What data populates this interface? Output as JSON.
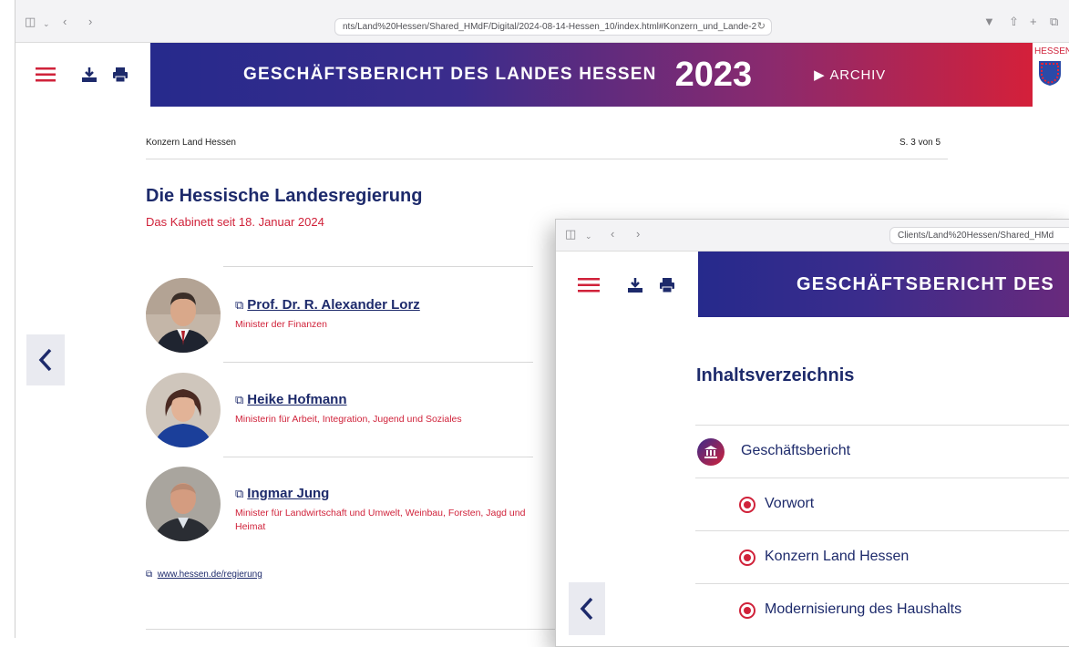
{
  "window1": {
    "url": "nts/Land%20Hessen/Shared_HMdF/Digital/2024-08-14-Hessen_10/index.html#Konzern_und_Lande-2",
    "toolbar": {
      "menu_icon": "hamburger-menu-icon",
      "download_icon": "download-icon",
      "print_icon": "print-icon"
    },
    "banner": {
      "title": "GESCHÄFTSBERICHT DES LANDES HESSEN",
      "year": "2023",
      "archive_label": "ARCHIV",
      "logo_text": "HESSEN"
    },
    "breadcrumb": "Konzern Land Hessen",
    "page_indicator": "S. 3 von 5",
    "heading": "Die Hessische Landesregierung",
    "subheading": "Das Kabinett seit 18. Januar 2024",
    "people": [
      {
        "name": "Prof. Dr. R. Alexander Lorz",
        "role": "Minister der Finanzen"
      },
      {
        "name": "Heike Hofmann",
        "role": "Ministerin für Arbeit, Integration, Jugend und Soziales"
      },
      {
        "name": "Ingmar Jung",
        "role": "Minister für Landwirtschaft und Umwelt, Weinbau, Forsten, Jagd und Heimat"
      }
    ],
    "weblink": "www.hessen.de/regierung"
  },
  "window2": {
    "url": "Clients/Land%20Hessen/Shared_HMd",
    "banner_title": "GESCHÄFTSBERICHT DES",
    "toc_title": "Inhaltsverzeichnis",
    "toc_items": [
      {
        "label": "Geschäftsbericht",
        "icon": "bank-icon"
      },
      {
        "label": "Vorwort",
        "icon": "radio-icon"
      },
      {
        "label": "Konzern Land Hessen",
        "icon": "radio-icon"
      },
      {
        "label": "Modernisierung des Haushalts",
        "icon": "radio-icon"
      }
    ]
  },
  "colors": {
    "navy": "#1d2a6b",
    "red": "#d0223a",
    "gradient_start": "#262a8c",
    "gradient_end": "#d4203a"
  }
}
